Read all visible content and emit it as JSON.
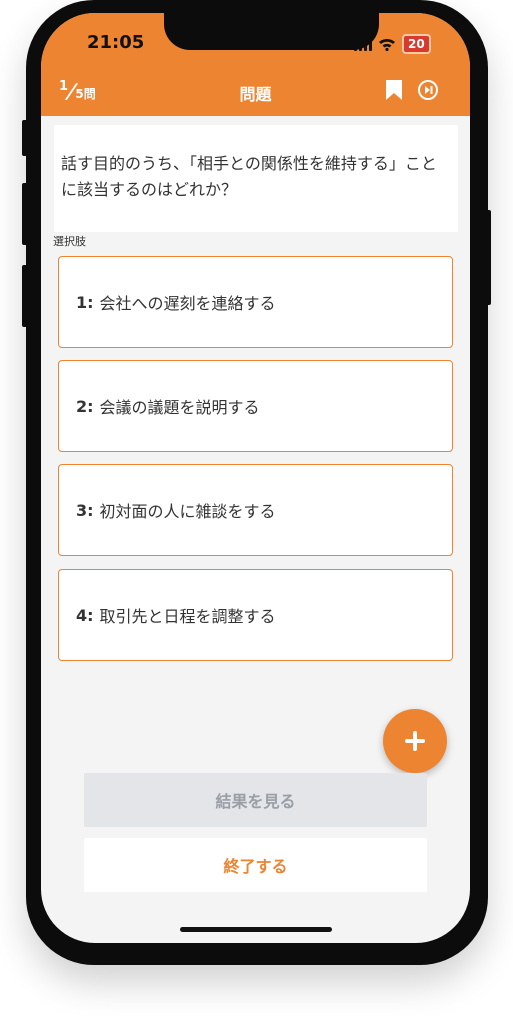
{
  "status_bar": {
    "time": "21:05",
    "battery": "20"
  },
  "header": {
    "question_index": "1",
    "question_total": "5",
    "question_total_unit": "問",
    "title": "問題"
  },
  "question": {
    "text": "話す目的のうち、「相手との関係性を維持する」ことに該当するのはどれか？"
  },
  "options_label": "選択肢",
  "options": [
    {
      "num": "1:",
      "text": "会社への遅刻を連絡する"
    },
    {
      "num": "2:",
      "text": "会議の議題を説明する"
    },
    {
      "num": "3:",
      "text": "初対面の人に雑談をする"
    },
    {
      "num": "4:",
      "text": "取引先と日程を調整する"
    }
  ],
  "buttons": {
    "result": "結果を見る",
    "end": "終了する"
  },
  "icons": {
    "bookmark": "bookmark-icon",
    "skip": "skip-next-icon",
    "fab": "plus-icon",
    "wifi": "wifi-icon",
    "signal": "signal-icon",
    "battery": "battery-icon"
  },
  "colors": {
    "accent": "#ec8431",
    "battery": "#d83a2e",
    "screen_bg": "#f4f4f4"
  }
}
